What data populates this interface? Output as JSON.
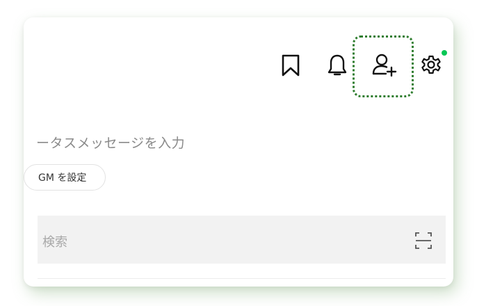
{
  "header": {
    "icons": {
      "bookmark": "bookmark-icon",
      "notifications": "bell-icon",
      "add_friend": "add-friend-icon",
      "settings": "gear-icon"
    },
    "notification_dot_color": "#06c755",
    "highlight_color": "#2e7d2e"
  },
  "profile": {
    "status_message_placeholder": "ータスメッセージを入力",
    "bgm_button_label": "GM を設定"
  },
  "search": {
    "placeholder": "検索",
    "scan_icon": "scan-icon"
  }
}
